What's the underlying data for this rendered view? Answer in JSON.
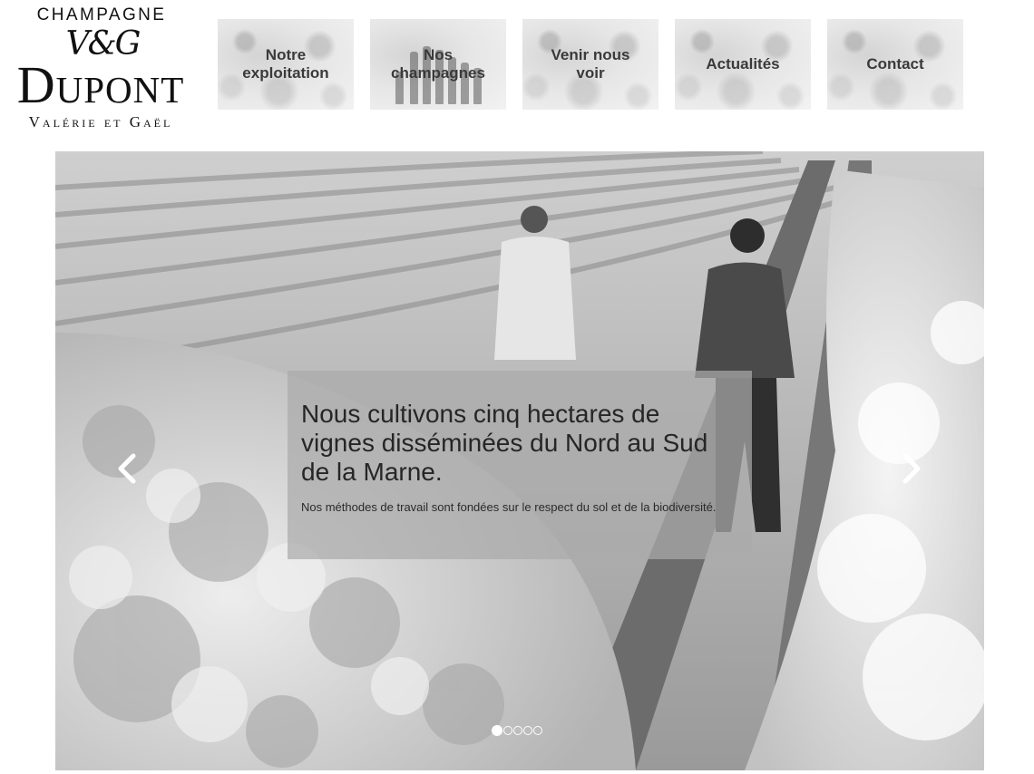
{
  "brand": {
    "top": "CHAMPAGNE",
    "monogram": "V&G",
    "name": "DupónT",
    "subtitle": "Valérie et Gaël"
  },
  "nav": [
    {
      "label_line1": "Notre",
      "label_line2": "exploitation"
    },
    {
      "label_line1": "Nos",
      "label_line2": "champagnes"
    },
    {
      "label_line1": "Venir nous",
      "label_line2": "voir"
    },
    {
      "label_line1": "Actualités",
      "label_line2": ""
    },
    {
      "label_line1": "Contact",
      "label_line2": ""
    }
  ],
  "slider": {
    "title": "Nous cultivons cinq hectares de vignes disséminées du Nord au Sud de la Marne.",
    "text": "Nos méthodes de travail sont fondées sur le respect du sol et de la biodiversité.",
    "prev_icon": "chevron-left-icon",
    "next_icon": "chevron-right-icon",
    "slide_count": 5,
    "active_slide": 1
  }
}
